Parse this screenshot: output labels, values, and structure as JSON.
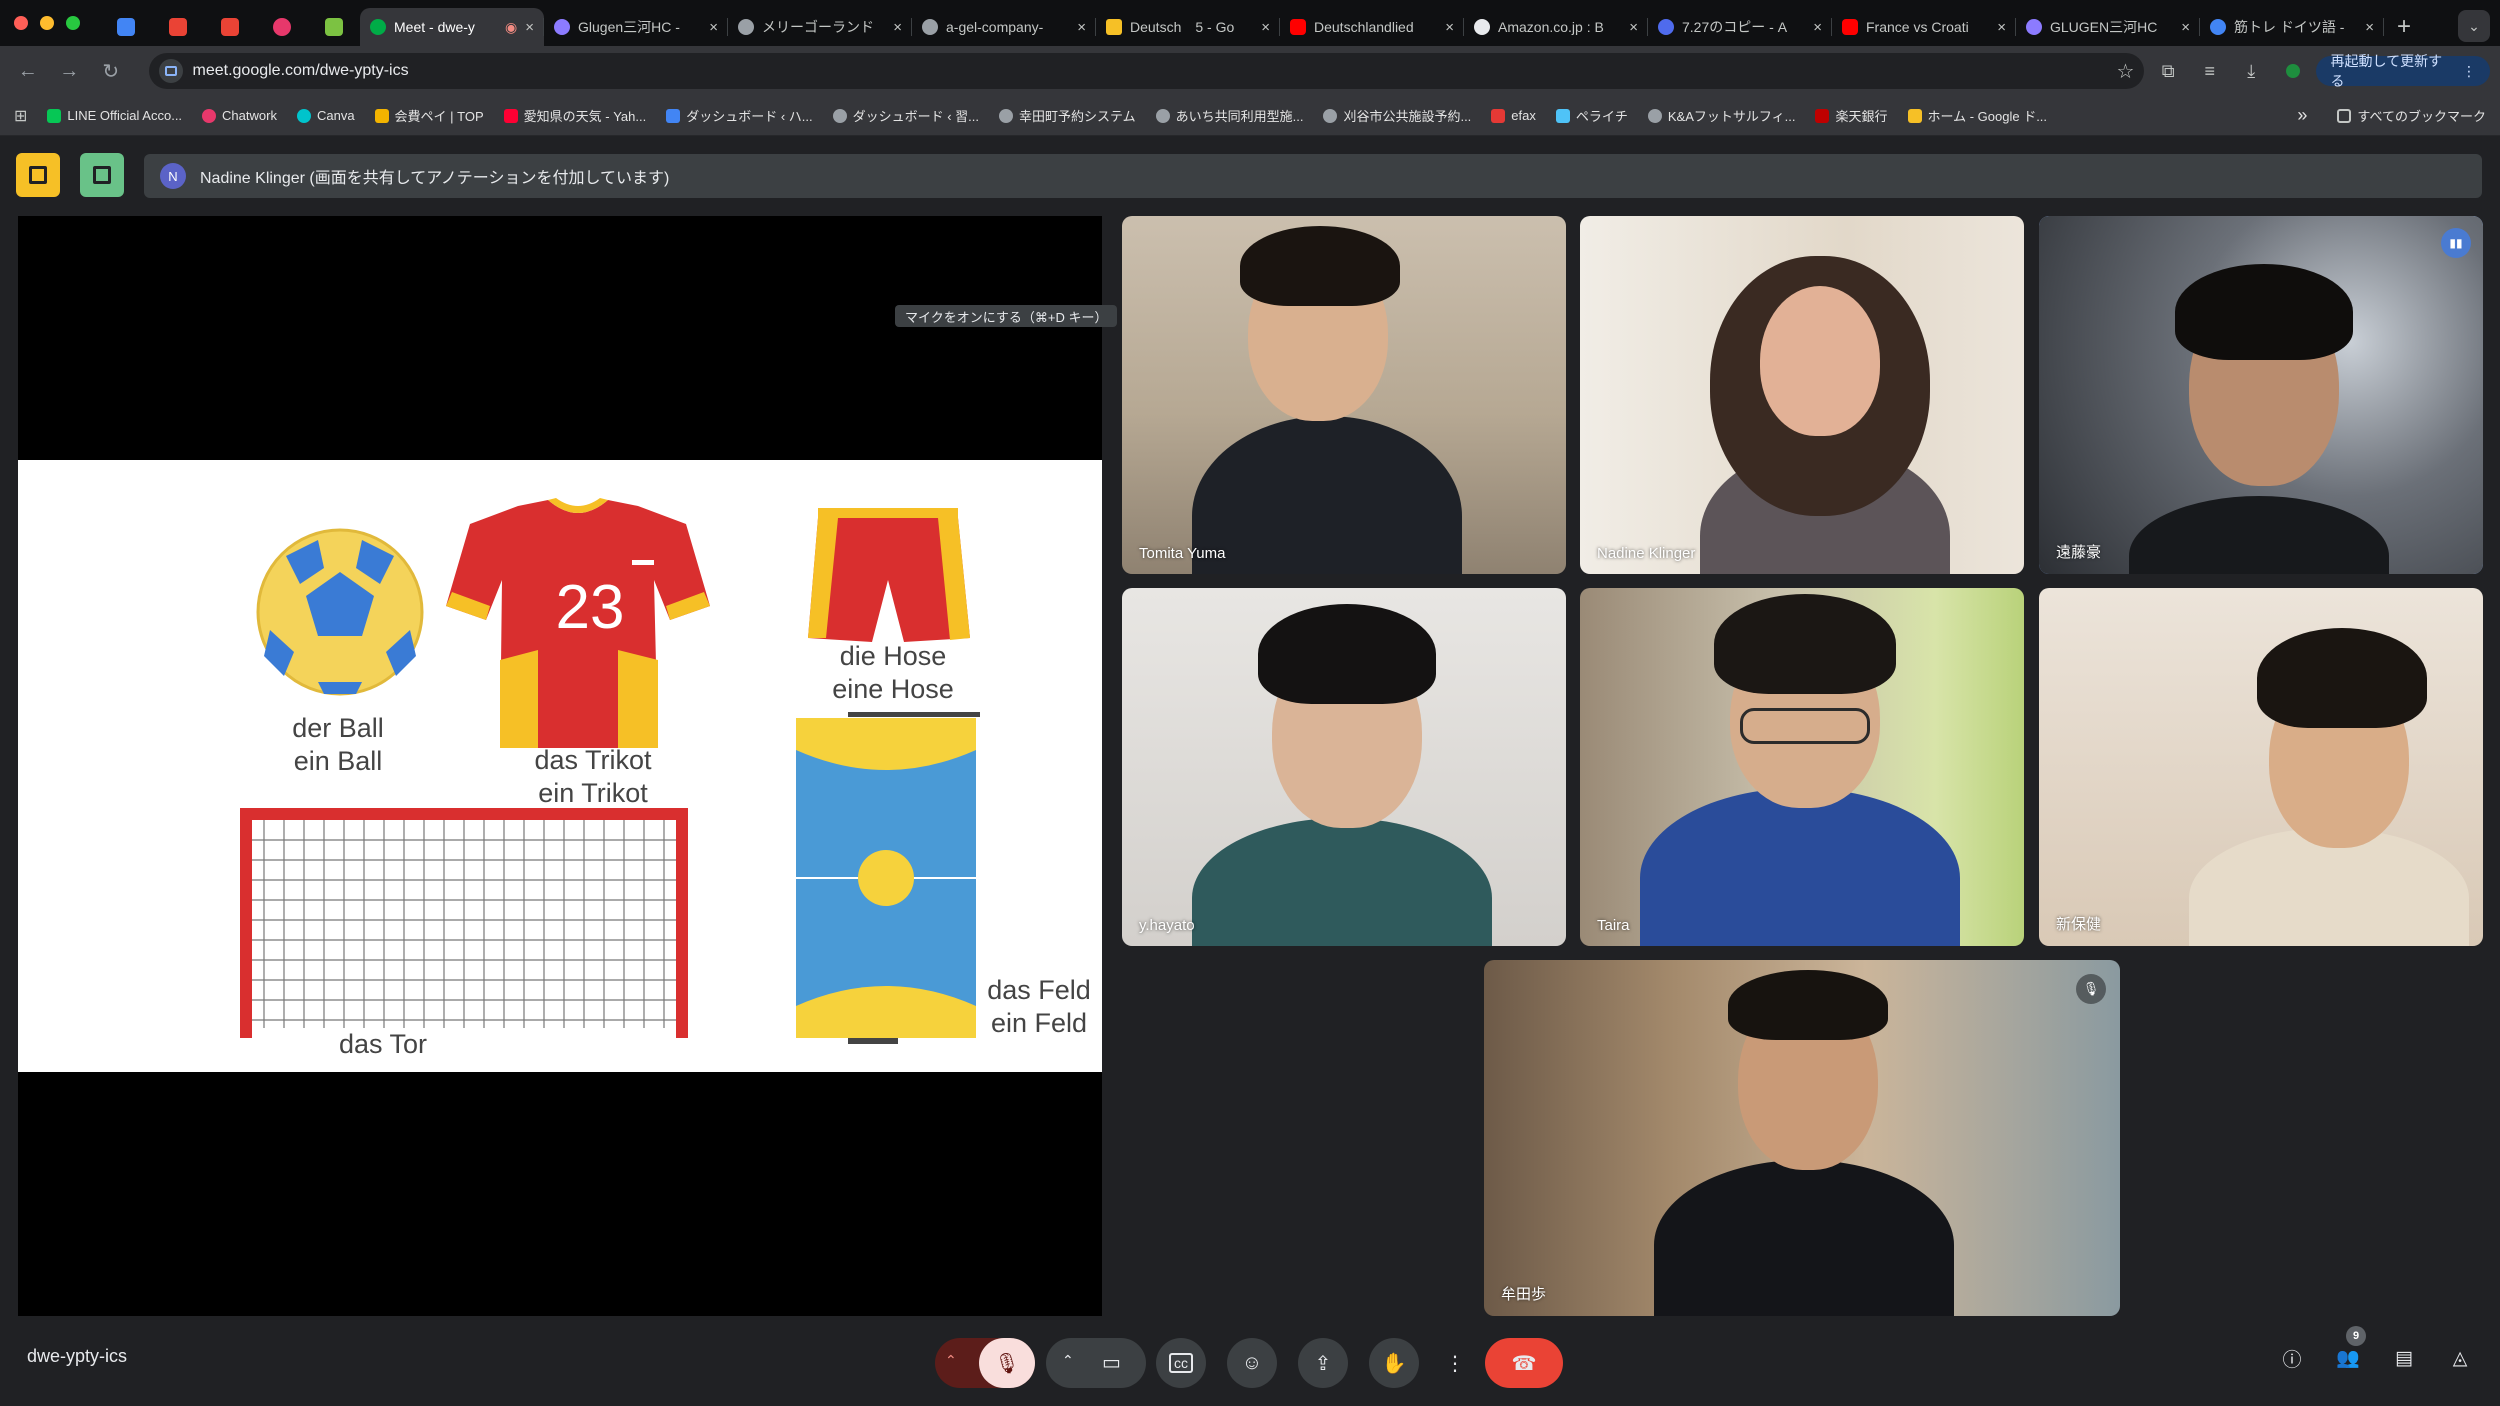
{
  "browser": {
    "traffic_colors": [
      "#ff5f57",
      "#febc2e",
      "#28c840"
    ],
    "pinned": [
      {
        "icon": "calendar-icon",
        "color": "#4285f4"
      },
      {
        "icon": "gmail-icon",
        "color": "#ea4335"
      },
      {
        "icon": "gmail-icon",
        "color": "#ea4335"
      },
      {
        "icon": "chatwork-icon",
        "color": "#e7386b"
      },
      {
        "icon": "app-icon",
        "color": "#7cc242"
      }
    ],
    "tabs": [
      {
        "label": "Meet - dwe-y",
        "active": true,
        "color": "#00ac47"
      },
      {
        "label": "Glugen三河HC -",
        "active": false,
        "color": "#8c7bff"
      },
      {
        "label": "メリーゴーランド",
        "active": false,
        "color": "#9aa0a6"
      },
      {
        "label": "a-gel-company-",
        "active": false,
        "color": "#9aa0a6"
      },
      {
        "label": "Deutsch　5 - Go",
        "active": false,
        "color": "#f6c026"
      },
      {
        "label": "Deutschlandlied",
        "active": false,
        "color": "#ff0000"
      },
      {
        "label": "Amazon.co.jp : B",
        "active": false,
        "color": "#e8eaed"
      },
      {
        "label": "7.27のコピー - A",
        "active": false,
        "color": "#4f6bed"
      },
      {
        "label": "France vs Croati",
        "active": false,
        "color": "#ff0000"
      },
      {
        "label": "GLUGEN三河HC",
        "active": false,
        "color": "#8c7bff"
      },
      {
        "label": "筋トレ ドイツ語 -",
        "active": false,
        "color": "#4285f4"
      }
    ],
    "tab_close": "×",
    "new_tab": "+",
    "tab_menu": "⌄",
    "url": "meet.google.com/dwe-ypty-ics",
    "update_button": "再起動して更新する",
    "bookmarks": [
      {
        "label": "LINE Official Acco...",
        "color": "#06c755"
      },
      {
        "label": "Chatwork",
        "color": "#e7386b"
      },
      {
        "label": "Canva",
        "color": "#00c4cc"
      },
      {
        "label": "会費ペイ | TOP",
        "color": "#f3b400"
      },
      {
        "label": "愛知県の天気 - Yah...",
        "color": "#ff0033"
      },
      {
        "label": "ダッシュボード ‹ ハ...",
        "color": "#4285f4"
      },
      {
        "label": "ダッシュボード ‹ 習...",
        "color": "#9aa0a6"
      },
      {
        "label": "幸田町予約システム",
        "color": "#9aa0a6"
      },
      {
        "label": "あいち共同利用型施...",
        "color": "#9aa0a6"
      },
      {
        "label": "刈谷市公共施設予約...",
        "color": "#9aa0a6"
      },
      {
        "label": "efax",
        "color": "#e53935"
      },
      {
        "label": "ペライチ",
        "color": "#4fc3f7"
      },
      {
        "label": "K&Aフットサルフィ...",
        "color": "#9aa0a6"
      },
      {
        "label": "楽天銀行",
        "color": "#bf0000"
      },
      {
        "label": "ホーム - Google ド...",
        "color": "#f6c026"
      }
    ],
    "bookmarks_overflow": "»",
    "all_bookmarks": "すべてのブックマーク"
  },
  "meet": {
    "presenter_initial": "N",
    "presenter_banner": "Nadine Klinger (画面を共有してアノテーションを付加しています)",
    "slide": {
      "ball_label": "der Ball\nein Ball",
      "trikot_label": "das Trikot\nein Trikot",
      "trikot_number": "23",
      "hose_label": "die Hose\neine Hose",
      "tor_label": "das Tor",
      "feld_label": "das Feld\nein Feld"
    },
    "participants": [
      {
        "name": "Tomita Yuma"
      },
      {
        "name": "Nadine Klinger"
      },
      {
        "name": "遠藤豪"
      },
      {
        "name": "y.hayato"
      },
      {
        "name": "Taira"
      },
      {
        "name": "新保健"
      },
      {
        "name": "牟田歩"
      }
    ],
    "meeting_code": "dwe-ypty-ics",
    "tooltip": "マイクをオンにする（⌘+D キー）",
    "people_count": "9",
    "colors": {
      "end_call": "#ea4335",
      "mic_off": "#f9dedc",
      "speaking": "#8ab4f8"
    }
  }
}
